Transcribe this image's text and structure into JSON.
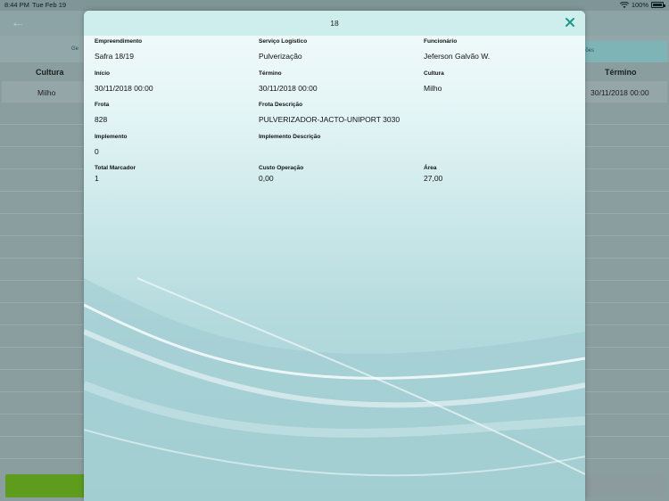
{
  "status_bar": {
    "time": "8:44 PM",
    "date": "Tue Feb 19",
    "battery": "100%"
  },
  "background": {
    "tab_left_label": "Ge",
    "tab_right_label": "ações",
    "columns": {
      "left": "Cultura",
      "right": "Término"
    },
    "row": {
      "left": "Milho",
      "right": "30/11/2018 00:00"
    }
  },
  "modal": {
    "title": "18",
    "fields": {
      "empreendimento": {
        "label": "Empreendimento",
        "value": "Safra 18/19"
      },
      "servico": {
        "label": "Serviço Logístico",
        "value": "Pulverização"
      },
      "funcionario": {
        "label": "Funcionário",
        "value": "Jeferson Galvão W."
      },
      "inicio": {
        "label": "Início",
        "value": "30/11/2018 00:00"
      },
      "termino": {
        "label": "Término",
        "value": "30/11/2018 00:00"
      },
      "cultura": {
        "label": "Cultura",
        "value": "Milho"
      },
      "frota": {
        "label": "Frota",
        "value": "828"
      },
      "frota_descricao": {
        "label": "Frota Descrição",
        "value": "PULVERIZADOR-JACTO-UNIPORT 3030"
      },
      "implemento": {
        "label": "Implemento",
        "value": "0"
      },
      "implemento_descricao": {
        "label": "Implemento Descrição",
        "value": ""
      },
      "total_marcador": {
        "label": "Total Marcador",
        "value": "1"
      },
      "custo_operacao": {
        "label": "Custo Operação",
        "value": "0,00"
      },
      "area": {
        "label": "Área",
        "value": "27,00"
      }
    }
  },
  "colors": {
    "accent": "#1a9a8c",
    "header": "#cdeeed",
    "green_button": "#5e9c1e"
  },
  "icons": {
    "back": "arrow-left-icon",
    "close": "close-icon",
    "wifi": "wifi-icon",
    "battery": "battery-icon"
  }
}
